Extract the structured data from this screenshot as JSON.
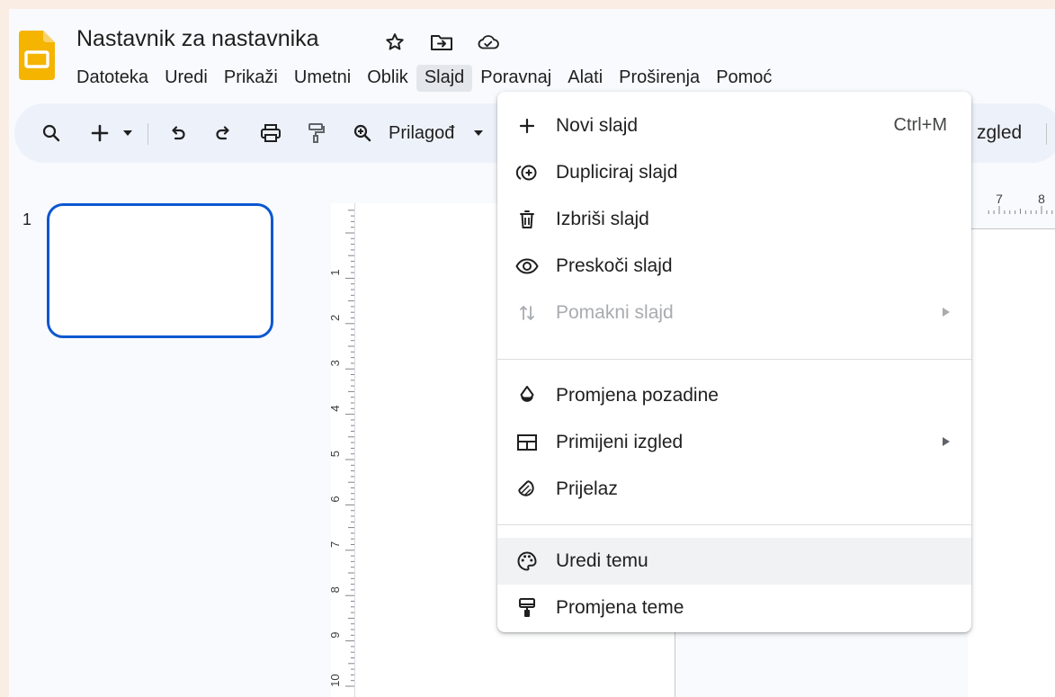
{
  "document": {
    "title": "Nastavnik za nastavnika"
  },
  "menu": [
    "Datoteka",
    "Uredi",
    "Prikaži",
    "Umetni",
    "Oblik",
    "Slajd",
    "Poravnaj",
    "Alati",
    "Proširenja",
    "Pomoć"
  ],
  "active_menu": "Slajd",
  "toolbar": {
    "zoom_label": "Prilagođ",
    "layout_label_partial": "zgled"
  },
  "slides": [
    {
      "number": "1"
    }
  ],
  "ruler": {
    "vertical_ticks": [
      "1",
      "2",
      "3",
      "4",
      "5",
      "6",
      "7",
      "8",
      "9",
      "10"
    ],
    "horizontal_ticks": [
      "7",
      "8"
    ]
  },
  "dropdown": {
    "items": [
      {
        "label": "Novi slajd",
        "shortcut": "Ctrl+M",
        "icon": "plus-icon"
      },
      {
        "label": "Dupliciraj slajd",
        "icon": "duplicate-slide-icon"
      },
      {
        "label": "Izbriši slajd",
        "icon": "trash-icon"
      },
      {
        "label": "Preskoči slajd",
        "icon": "eye-icon"
      },
      {
        "label": "Pomakni slajd",
        "icon": "move-arrows-icon",
        "disabled": true,
        "submenu": true
      },
      {
        "label": "Promjena pozadine",
        "icon": "fill-drop-icon"
      },
      {
        "label": "Primijeni izgled",
        "icon": "layout-icon",
        "submenu": true
      },
      {
        "label": "Prijelaz",
        "icon": "transition-icon"
      },
      {
        "label": "Uredi temu",
        "icon": "palette-icon",
        "highlighted": true
      },
      {
        "label": "Promjena teme",
        "icon": "paint-roller-icon"
      }
    ]
  },
  "colors": {
    "accent": "#0b57d0",
    "logo": "#f4b400",
    "toolbar_bg": "#edf2fa",
    "page_border": "#f9ede4"
  }
}
